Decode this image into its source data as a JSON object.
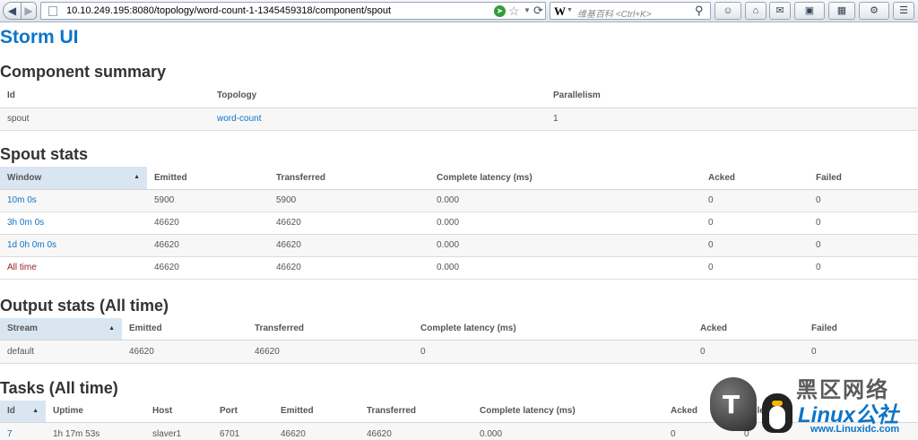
{
  "browser": {
    "url": "10.10.249.195:8080/topology/word-count-1-1345459318/component/spout",
    "search_placeholder": "维基百科 <Ctrl+K>",
    "search_engine_icon": "W"
  },
  "page": {
    "brand": "Storm UI"
  },
  "component_summary": {
    "title": "Component summary",
    "headers": [
      "Id",
      "Topology",
      "Parallelism"
    ],
    "row": {
      "id": "spout",
      "topology": "word-count",
      "parallelism": "1"
    }
  },
  "spout_stats": {
    "title": "Spout stats",
    "headers": [
      "Window",
      "Emitted",
      "Transferred",
      "Complete latency (ms)",
      "Acked",
      "Failed"
    ],
    "rows": [
      {
        "window": "10m 0s",
        "emitted": "5900",
        "transferred": "5900",
        "latency": "0.000",
        "acked": "0",
        "failed": "0"
      },
      {
        "window": "3h 0m 0s",
        "emitted": "46620",
        "transferred": "46620",
        "latency": "0.000",
        "acked": "0",
        "failed": "0"
      },
      {
        "window": "1d 0h 0m 0s",
        "emitted": "46620",
        "transferred": "46620",
        "latency": "0.000",
        "acked": "0",
        "failed": "0"
      },
      {
        "window": "All time",
        "emitted": "46620",
        "transferred": "46620",
        "latency": "0.000",
        "acked": "0",
        "failed": "0"
      }
    ]
  },
  "output_stats": {
    "title": "Output stats (All time)",
    "headers": [
      "Stream",
      "Emitted",
      "Transferred",
      "Complete latency (ms)",
      "Acked",
      "Failed"
    ],
    "row": {
      "stream": "default",
      "emitted": "46620",
      "transferred": "46620",
      "latency": "0",
      "acked": "0",
      "failed": "0"
    }
  },
  "tasks": {
    "title": "Tasks (All time)",
    "headers": [
      "Id",
      "Uptime",
      "Host",
      "Port",
      "Emitted",
      "Transferred",
      "Complete latency (ms)",
      "Acked",
      "Failed"
    ],
    "row": {
      "id": "7",
      "uptime": "1h 17m 53s",
      "host": "slaver1",
      "port": "6701",
      "emitted": "46620",
      "transferred": "46620",
      "latency": "0.000",
      "acked": "0",
      "failed": "0"
    }
  },
  "watermark": {
    "cn": "黑区网络",
    "brand": "Linux公社",
    "site": "www.Linuxidc.com"
  },
  "colors": {
    "link": "#0d74c8",
    "sorted_header": "#d9e6f2",
    "alltime": "#9b1c1c"
  }
}
